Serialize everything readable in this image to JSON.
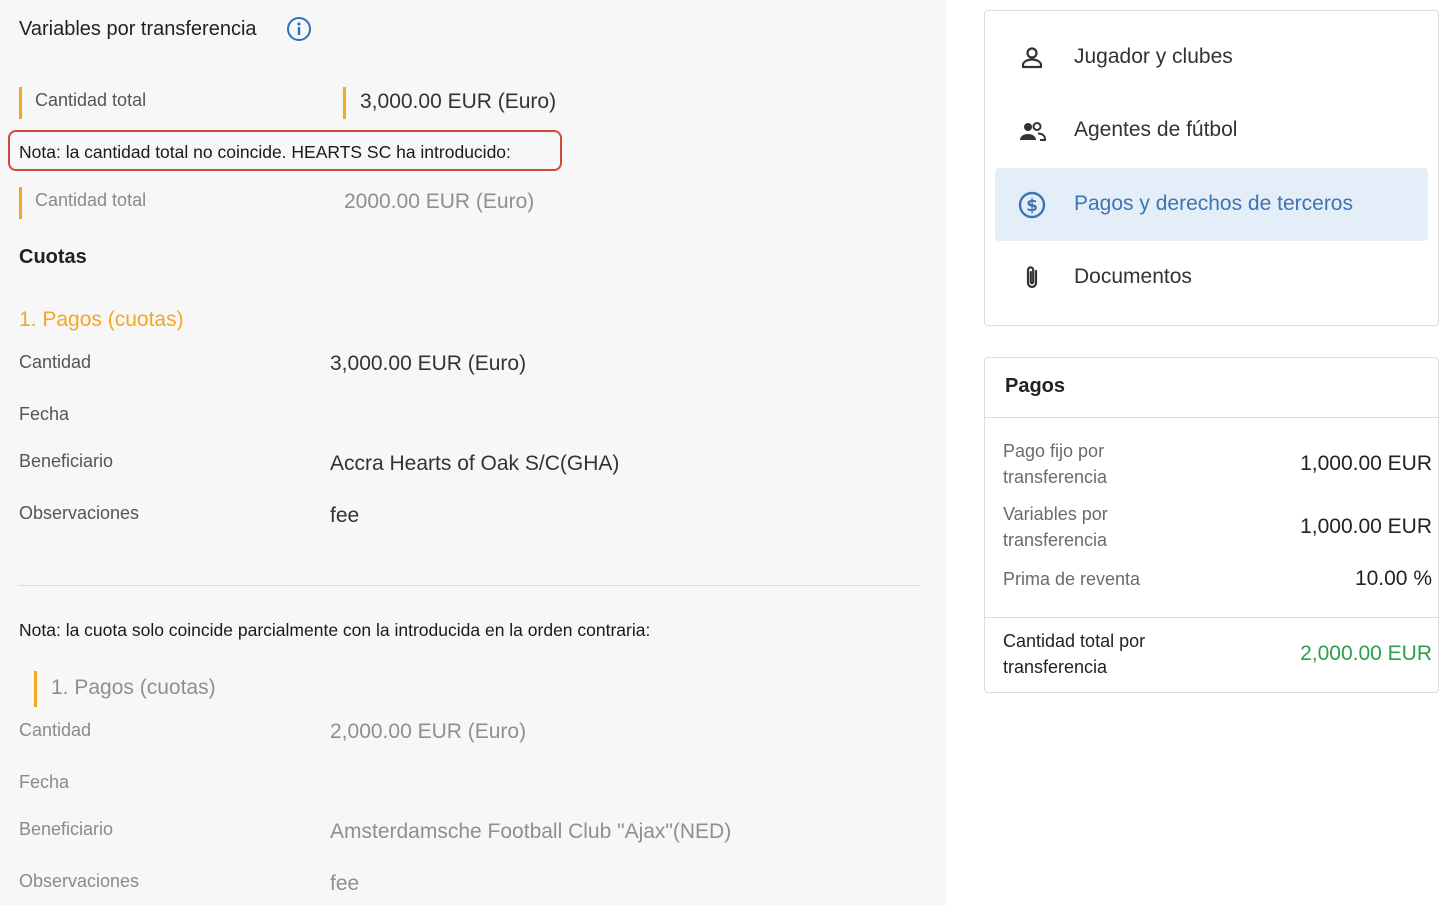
{
  "section": {
    "title": "Variables por transferencia",
    "total_label": "Cantidad total",
    "total_value": "3,000.00 EUR (Euro)",
    "mismatch_note": "Nota: la cantidad total no coincide. HEARTS SC ha introducido:",
    "other_total_label": "Cantidad total",
    "other_total_value": "2000.00 EUR (Euro)"
  },
  "cuotas": {
    "title": "Cuotas",
    "installment_title": "1. Pagos (cuotas)",
    "fields": [
      {
        "label": "Cantidad",
        "value": "3,000.00 EUR (Euro)"
      },
      {
        "label": "Fecha",
        "value": ""
      },
      {
        "label": "Beneficiario",
        "value": "Accra Hearts of Oak S/C(GHA)"
      },
      {
        "label": "Observaciones",
        "value": "fee"
      }
    ]
  },
  "partial": {
    "note": "Nota: la cuota solo coincide parcialmente con la introducida en la orden contraria:",
    "installment_title": "1. Pagos (cuotas)",
    "fields": [
      {
        "label": "Cantidad",
        "value": "2,000.00 EUR (Euro)"
      },
      {
        "label": "Fecha",
        "value": ""
      },
      {
        "label": "Beneficiario",
        "value": "Amsterdamsche Football Club \"Ajax\"(NED)"
      },
      {
        "label": "Observaciones",
        "value": "fee"
      }
    ]
  },
  "nav": {
    "items": [
      {
        "label": "Jugador y clubes",
        "icon": "person-icon",
        "active": false
      },
      {
        "label": "Agentes de fútbol",
        "icon": "people-icon",
        "active": false
      },
      {
        "label": "Pagos y derechos de terceros",
        "icon": "dollar-circle-icon",
        "active": true
      },
      {
        "label": "Documentos",
        "icon": "paperclip-icon",
        "active": false
      }
    ]
  },
  "payments": {
    "title": "Pagos",
    "rows": [
      {
        "label": "Pago fijo por transferencia",
        "value": "1,000.00 EUR"
      },
      {
        "label": "Variables por transferencia",
        "value": "1,000.00 EUR"
      },
      {
        "label": "Prima de reventa",
        "value": "10.00 %"
      }
    ],
    "total_label": "Cantidad total por transferencia",
    "total_value": "2,000.00 EUR"
  },
  "colors": {
    "accent_orange": "#f5a623",
    "highlight_red": "#d04a3b",
    "active_nav_bg": "#e3eef9",
    "active_nav_text": "#3d74b4",
    "total_green": "#2e9e4a"
  }
}
